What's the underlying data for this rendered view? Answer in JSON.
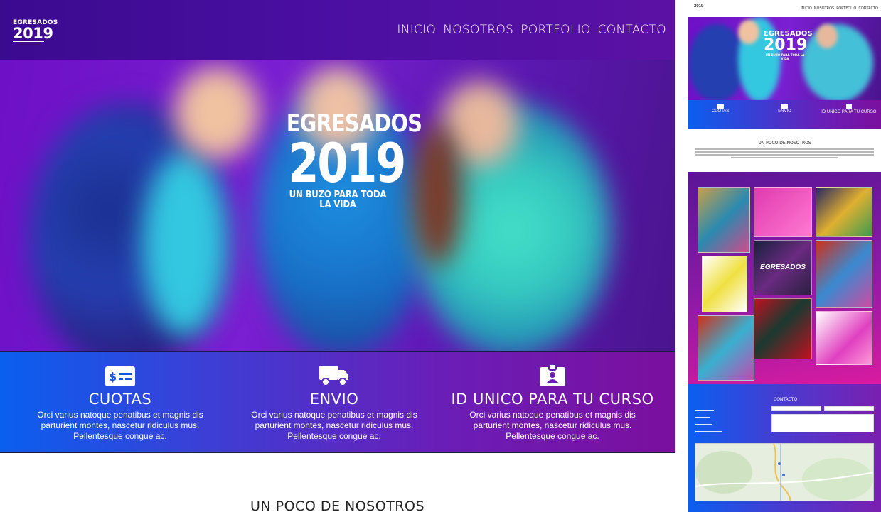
{
  "header": {
    "logo_top": "EGRESADOS",
    "logo_year": "2019",
    "logo_sub": "UN BUZO PARA TODA LA VIDA"
  },
  "nav": {
    "items": [
      "INICIO",
      "NOSOTROS",
      "PORTFOLIO",
      "CONTACTO"
    ]
  },
  "hero": {
    "title": "EGRESADOS",
    "year": "2019",
    "tagline": "UN BUZO PARA TODA LA VIDA"
  },
  "features": [
    {
      "icon": "money-icon",
      "title": "CUOTAS",
      "text": "Orci varius natoque penatibus et magnis dis parturient montes, nascetur ridiculus mus. Pellentesque congue ac."
    },
    {
      "icon": "truck-icon",
      "title": "ENVIO",
      "text": "Orci varius natoque penatibus et magnis dis parturient montes, nascetur ridiculus mus. Pellentesque congue ac."
    },
    {
      "icon": "id-badge-icon",
      "title": "ID UNICO PARA TU CURSO",
      "text": "Orci varius natoque penatibus et magnis dis parturient montes, nascetur ridiculus mus. Pellentesque congue ac."
    }
  ],
  "about": {
    "heading": "UN POCO DE NOSOTROS"
  },
  "thumbnail": {
    "nav": [
      "INICIO",
      "NOSOTROS",
      "PORTFOLIO",
      "CONTACTO"
    ],
    "logo": "2019",
    "hero_title": "EGRESADOS",
    "hero_year": "2019",
    "hero_tag": "UN BUZO PARA TODA LA VIDA",
    "features": [
      "CUOTAS",
      "ENVIO",
      "ID UNICO PARA TU CURSO"
    ],
    "about_heading": "UN POCO DE NOSOTROS",
    "contact_heading": "CONTACTO",
    "portfolio_tile_text": "EGRESADOS"
  },
  "colors": {
    "header": "#3a0a8f",
    "feature_start": "#0a5fef",
    "feature_end": "#7b0f9e",
    "portfolio_end": "#d81ba0"
  }
}
